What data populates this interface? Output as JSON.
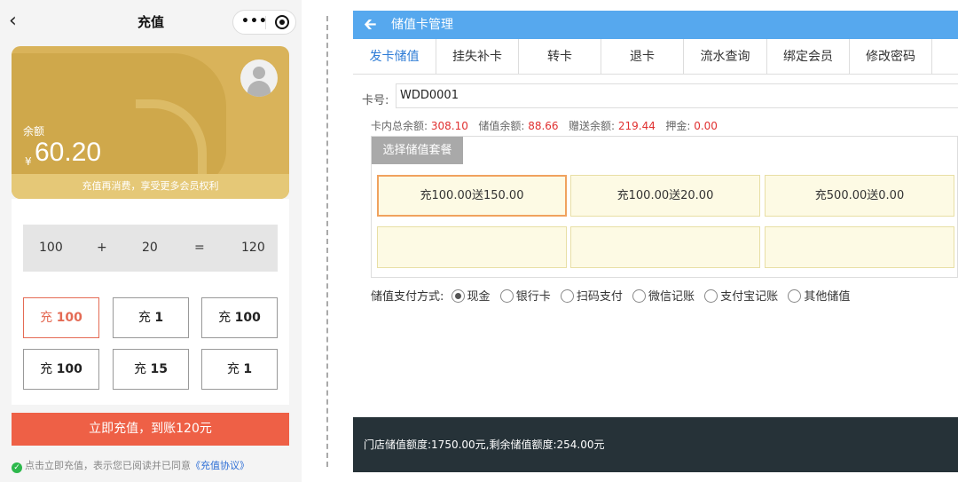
{
  "phone": {
    "nav": {
      "back_glyph": "‹",
      "title": "充值",
      "more_glyph": "•••"
    },
    "card": {
      "balance_label": "余额",
      "currency": "¥",
      "balance": "60.20",
      "footer_text": "充值再消费，享受更多会员权利"
    },
    "formula": {
      "base": "100",
      "plus": "+",
      "bonus": "20",
      "equals": "=",
      "total": "120"
    },
    "options": [
      {
        "prefix": "充",
        "amount": "100"
      },
      {
        "prefix": "充",
        "amount": "1"
      },
      {
        "prefix": "充",
        "amount": "100"
      },
      {
        "prefix": "充",
        "amount": "100"
      },
      {
        "prefix": "充",
        "amount": "15"
      },
      {
        "prefix": "充",
        "amount": "1"
      }
    ],
    "cta_label": "立即充值，到账120元",
    "agreement": {
      "check_glyph": "✓",
      "text": "点击立即充值，表示您已阅读并已同意",
      "link": "《充值协议》"
    }
  },
  "desk": {
    "title": "储值卡管理",
    "tabs": [
      "发卡储值",
      "挂失补卡",
      "转卡",
      "退卡",
      "流水查询",
      "绑定会员",
      "修改密码"
    ],
    "card_no_label": "卡号:",
    "card_no": "WDD0001",
    "balances": {
      "total_label": "卡内总余额:",
      "total": "308.10",
      "stored_label": "储值余额:",
      "stored": "88.66",
      "gift_label": "赠送余额:",
      "gift": "219.44",
      "deposit_label": "押金:",
      "deposit": "0.00"
    },
    "package_tab": "选择储值套餐",
    "packages": [
      "充100.00送150.00",
      "充100.00送20.00",
      "充500.00送0.00"
    ],
    "pay_label": "储值支付方式:",
    "pay_methods": [
      "现金",
      "银行卡",
      "扫码支付",
      "微信记账",
      "支付宝记账",
      "其他储值"
    ],
    "footer": "门店储值额度:1750.00元,剩余储值额度:254.00元"
  },
  "colors": {
    "accent_blue": "#56a8ee",
    "cta_red": "#ee6046",
    "card_gold": "#d9b35a",
    "footer_dark": "#263238"
  }
}
